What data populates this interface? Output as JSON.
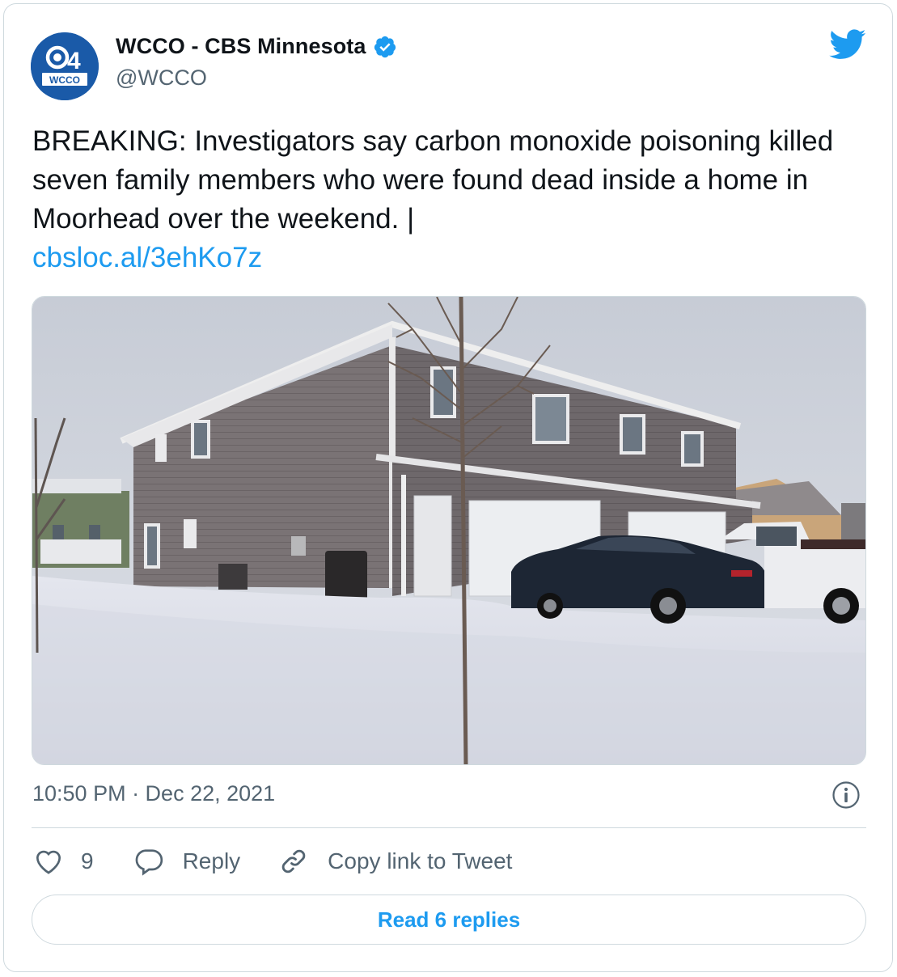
{
  "author": {
    "display_name": "WCCO - CBS Minnesota",
    "handle": "@WCCO",
    "avatar_logo": {
      "number": "04",
      "station": "WCCO"
    },
    "verified": true
  },
  "tweet": {
    "text": "BREAKING: Investigators say carbon monoxide poisoning killed seven family members who were found dead inside a home in Moorhead over the weekend. |",
    "link": "cbsloc.al/3ehKo7z",
    "timestamp": "10:50 PM · Dec 22, 2021"
  },
  "actions": {
    "like_count": "9",
    "reply_label": "Reply",
    "copy_link_label": "Copy link to Tweet"
  },
  "read_replies_label": "Read 6 replies",
  "colors": {
    "accent": "#1d9bf0",
    "secondary_text": "#536471",
    "border": "#cfd9de"
  },
  "icons": [
    "twitter-bird-icon",
    "verified-badge-icon",
    "info-icon",
    "heart-icon",
    "reply-bubble-icon",
    "link-icon"
  ]
}
